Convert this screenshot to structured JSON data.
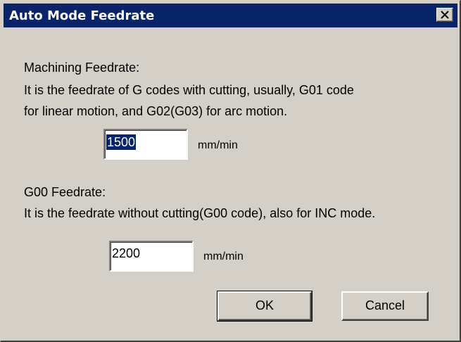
{
  "window": {
    "title": "Auto Mode Feedrate",
    "close_glyph": "✕"
  },
  "machining": {
    "heading": "Machining Feedrate:",
    "description_line1": "It is the feedrate of G codes with cutting, usually, G01 code",
    "description_line2": "for linear motion, and G02(G03) for arc motion.",
    "value": "1500",
    "unit": "mm/min"
  },
  "g00": {
    "heading": "G00 Feedrate:",
    "description": "It is the feedrate without cutting(G00 code), also for INC mode.",
    "value": "2200",
    "unit": "mm/min"
  },
  "buttons": {
    "ok": "OK",
    "cancel": "Cancel"
  },
  "colors": {
    "titlebar": "#0a246a",
    "face": "#d4d0c8",
    "selection": "#0a246a"
  }
}
